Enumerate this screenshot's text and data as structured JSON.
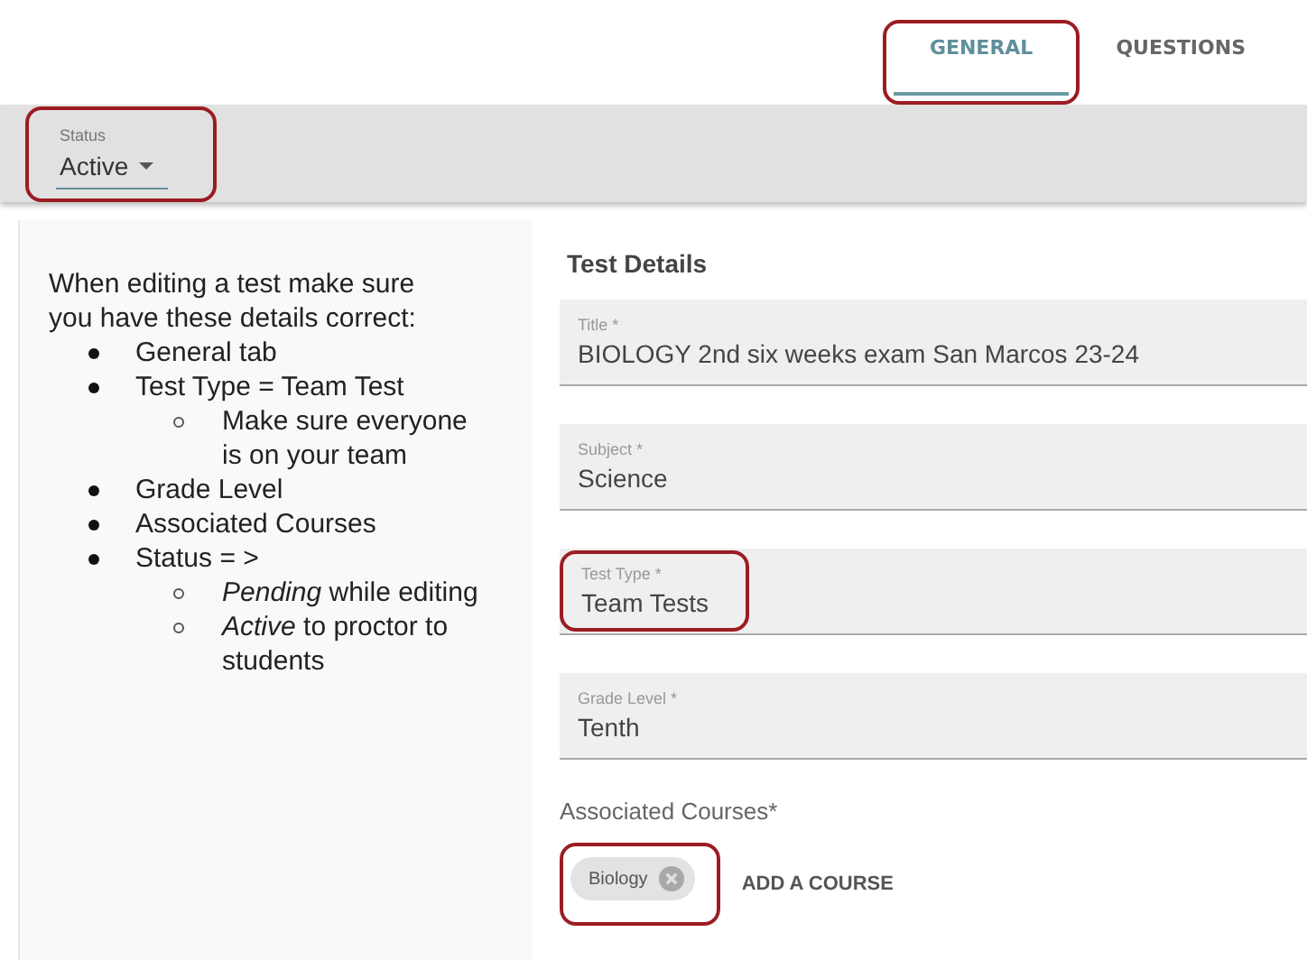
{
  "tabs": [
    {
      "label": "GENERAL",
      "selected": true,
      "highlighted": true
    },
    {
      "label": "QUESTIONS",
      "selected": false,
      "highlighted": false
    }
  ],
  "status": {
    "label": "Status",
    "value": "Active",
    "highlighted": true
  },
  "notes": {
    "intro": "When editing a test make sure you have these details correct:",
    "items": [
      {
        "text": "General tab"
      },
      {
        "text": "Test Type = Team Test",
        "children": [
          {
            "text": "Make sure everyone is on your team"
          }
        ]
      },
      {
        "text": "Grade Level"
      },
      {
        "text": "Associated Courses"
      },
      {
        "text": "Status = >",
        "children": [
          {
            "text": "*Pending* while editing"
          },
          {
            "text": "*Active* to proctor to students"
          }
        ]
      }
    ]
  },
  "details": {
    "heading": "Test Details",
    "fields": [
      {
        "label": "Title *",
        "value": "BIOLOGY 2nd six weeks exam San Marcos 23-24",
        "highlighted": false
      },
      {
        "label": "Subject *",
        "value": "Science",
        "highlighted": false
      },
      {
        "label": "Test Type *",
        "value": "Team Tests",
        "highlighted": true
      },
      {
        "label": "Grade Level *",
        "value": "Tenth",
        "highlighted": false
      }
    ],
    "courses": {
      "label": "Associated Courses*",
      "chips": [
        {
          "label": "Biology",
          "highlighted": true
        }
      ],
      "add_button": "ADD A COURSE"
    }
  }
}
